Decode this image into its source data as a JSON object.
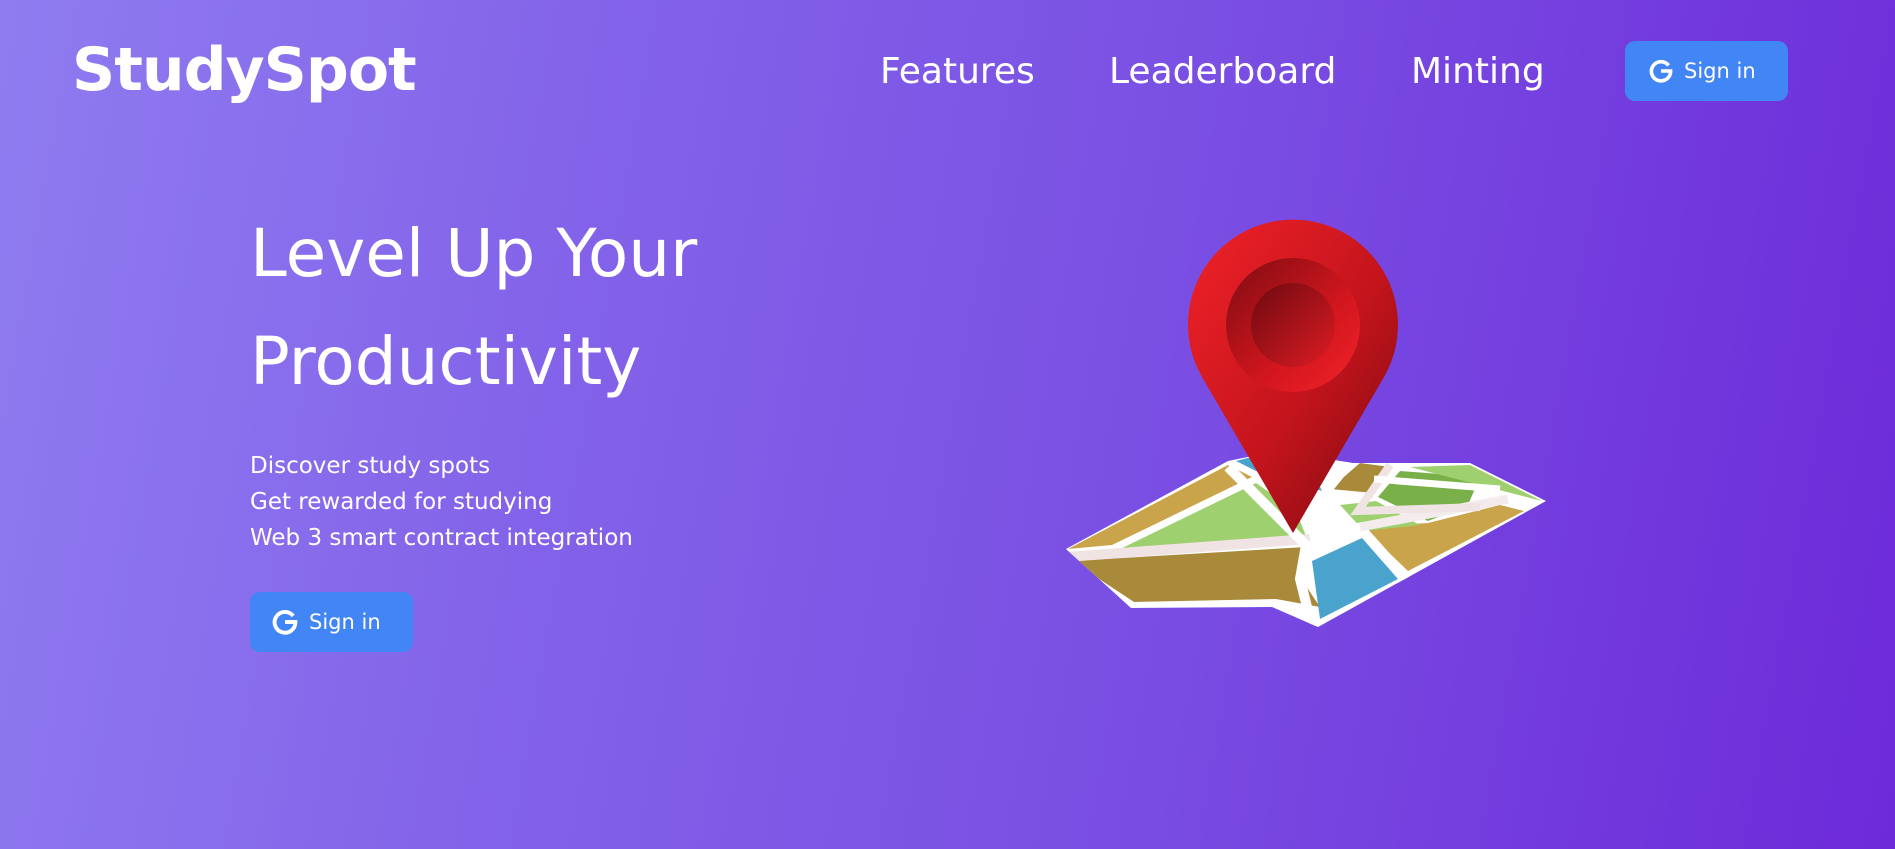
{
  "header": {
    "logo": "StudySpot",
    "nav": {
      "features": "Features",
      "leaderboard": "Leaderboard",
      "minting": "Minting"
    },
    "sign_in_label": "Sign in"
  },
  "hero": {
    "title_line1": "Level Up Your",
    "title_line2": "Productivity",
    "features": [
      "Discover study spots",
      "Get rewarded for studying",
      "Web 3 smart contract integration"
    ],
    "sign_in_label": "Sign in",
    "illustration": "map-pin-on-map-icon"
  },
  "icons": {
    "sign_in": "google-g-icon"
  },
  "colors": {
    "background_start": "#8f7cf0",
    "background_end": "#6d2ad9",
    "button": "#4285f4",
    "text": "#ffffff",
    "pin": "#e01b24"
  }
}
